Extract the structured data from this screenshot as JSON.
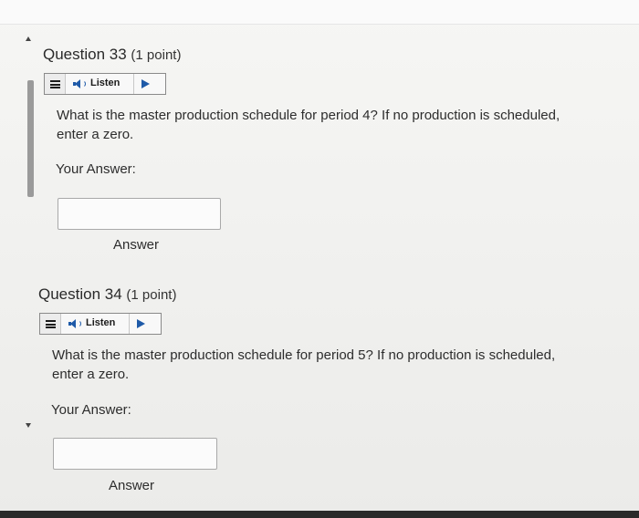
{
  "questions": [
    {
      "title": "Question 33",
      "points": "(1 point)",
      "listen_label": "Listen",
      "text_line1": "What is the master production schedule for period 4? If no production is scheduled,",
      "text_line2": "enter a zero.",
      "your_answer_label": "Your Answer:",
      "answer_value": "",
      "answer_caption": "Answer"
    },
    {
      "title": "Question 34",
      "points": "(1 point)",
      "listen_label": "Listen",
      "text_line1": "What is the master production schedule for period 5? If no production is scheduled,",
      "text_line2": "enter a zero.",
      "your_answer_label": "Your Answer:",
      "answer_value": "",
      "answer_caption": "Answer"
    }
  ],
  "colors": {
    "accent": "#1e5aa8",
    "scroll_thumb": "#9a9a9a",
    "background": "#f3f3f1"
  },
  "icons": {
    "menu": "hamburger-menu-icon",
    "speaker": "speaker-icon",
    "play": "play-icon"
  }
}
